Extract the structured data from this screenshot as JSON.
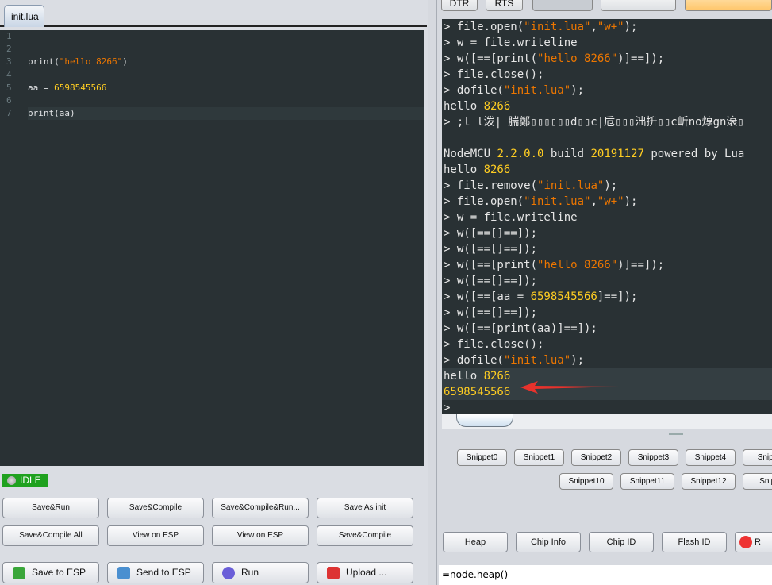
{
  "editor": {
    "tab": "init.lua",
    "line_numbers": [
      "1",
      "2",
      "3",
      "4",
      "5",
      "6",
      "7"
    ],
    "lines": [
      [],
      [],
      [
        {
          "t": "print(",
          "c": ""
        },
        {
          "t": "\"hello 8266\"",
          "c": "str"
        },
        {
          "t": ")",
          "c": ""
        }
      ],
      [],
      [
        {
          "t": "aa = ",
          "c": ""
        },
        {
          "t": "6598545566",
          "c": "num"
        }
      ],
      [],
      [
        {
          "t": "print(aa)",
          "c": ""
        }
      ]
    ]
  },
  "status": {
    "label": "IDLE",
    "color": "#1fa11f"
  },
  "buttons": {
    "row1": [
      "Save&Run",
      "Save&Compile",
      "Save&Compile&Run...",
      "Save As init"
    ],
    "row2": [
      "Save&Compile All",
      "View on ESP",
      "View on ESP",
      "Save&Compile"
    ],
    "row3": [
      "Save to ESP",
      "Send to ESP",
      "Run",
      "Upload ..."
    ]
  },
  "top_buttons": [
    "DTR",
    "RTS"
  ],
  "terminal": {
    "lines": [
      [
        {
          "t": "> file.open(",
          "c": ""
        },
        {
          "t": "\"init.lua\"",
          "c": "str"
        },
        {
          "t": ",",
          "c": ""
        },
        {
          "t": "\"w+\"",
          "c": "str"
        },
        {
          "t": ");",
          "c": ""
        }
      ],
      [
        {
          "t": "> w = file.writeline",
          "c": ""
        }
      ],
      [
        {
          "t": "> w([==[print(",
          "c": ""
        },
        {
          "t": "\"hello 8266\"",
          "c": "str"
        },
        {
          "t": ")]==]);",
          "c": ""
        }
      ],
      [
        {
          "t": "> file.close();",
          "c": ""
        }
      ],
      [
        {
          "t": "> dofile(",
          "c": ""
        },
        {
          "t": "\"init.lua\"",
          "c": "str"
        },
        {
          "t": ");",
          "c": ""
        }
      ],
      [
        {
          "t": "hello ",
          "c": ""
        },
        {
          "t": "8266",
          "c": "num"
        }
      ],
      [
        {
          "t": "> ;l l泼| 腨鄭▯▯▯▯▯▯d▯▯c|卮▯▯▯泏抍▯▯c岓no焞gn滖▯",
          "c": ""
        }
      ],
      [],
      [
        {
          "t": "NodeMCU ",
          "c": ""
        },
        {
          "t": "2.2.0.0",
          "c": "num"
        },
        {
          "t": " build ",
          "c": ""
        },
        {
          "t": "20191127",
          "c": "num"
        },
        {
          "t": " powered by Lua",
          "c": ""
        }
      ],
      [
        {
          "t": "hello ",
          "c": ""
        },
        {
          "t": "8266",
          "c": "num"
        }
      ],
      [
        {
          "t": "> file.remove(",
          "c": ""
        },
        {
          "t": "\"init.lua\"",
          "c": "str"
        },
        {
          "t": ");",
          "c": ""
        }
      ],
      [
        {
          "t": "> file.open(",
          "c": ""
        },
        {
          "t": "\"init.lua\"",
          "c": "str"
        },
        {
          "t": ",",
          "c": ""
        },
        {
          "t": "\"w+\"",
          "c": "str"
        },
        {
          "t": ");",
          "c": ""
        }
      ],
      [
        {
          "t": "> w = file.writeline",
          "c": ""
        }
      ],
      [
        {
          "t": "> w([==[]==]);",
          "c": ""
        }
      ],
      [
        {
          "t": "> w([==[]==]);",
          "c": ""
        }
      ],
      [
        {
          "t": "> w([==[print(",
          "c": ""
        },
        {
          "t": "\"hello 8266\"",
          "c": "str"
        },
        {
          "t": ")]==]);",
          "c": ""
        }
      ],
      [
        {
          "t": "> w([==[]==]);",
          "c": ""
        }
      ],
      [
        {
          "t": "> w([==[aa = ",
          "c": ""
        },
        {
          "t": "6598545566",
          "c": "num"
        },
        {
          "t": "]==]);",
          "c": ""
        }
      ],
      [
        {
          "t": "> w([==[]==]);",
          "c": ""
        }
      ],
      [
        {
          "t": "> w([==[print(aa)]==]);",
          "c": ""
        }
      ],
      [
        {
          "t": "> file.close();",
          "c": ""
        }
      ],
      [
        {
          "t": "> dofile(",
          "c": ""
        },
        {
          "t": "\"init.lua\"",
          "c": "str"
        },
        {
          "t": ");",
          "c": ""
        }
      ],
      [
        {
          "t": "hello ",
          "c": ""
        },
        {
          "t": "8266",
          "c": "num"
        }
      ],
      [
        {
          "t": "6598545566",
          "c": "num"
        }
      ],
      [
        {
          "t": ">",
          "c": ""
        }
      ]
    ]
  },
  "snippets": {
    "row1": [
      "Snippet0",
      "Snippet1",
      "Snippet2",
      "Snippet3",
      "Snippet4",
      "Snipp"
    ],
    "row2": [
      "Snippet10",
      "Snippet11",
      "Snippet12",
      "Snipp"
    ]
  },
  "info_buttons": [
    "Heap",
    "Chip Info",
    "Chip ID",
    "Flash ID",
    "R"
  ],
  "command_input": "=node.heap()",
  "colors": {
    "annotation_arrow": "#e8322c",
    "string": "#ec7600",
    "number": "#ffcd22"
  }
}
